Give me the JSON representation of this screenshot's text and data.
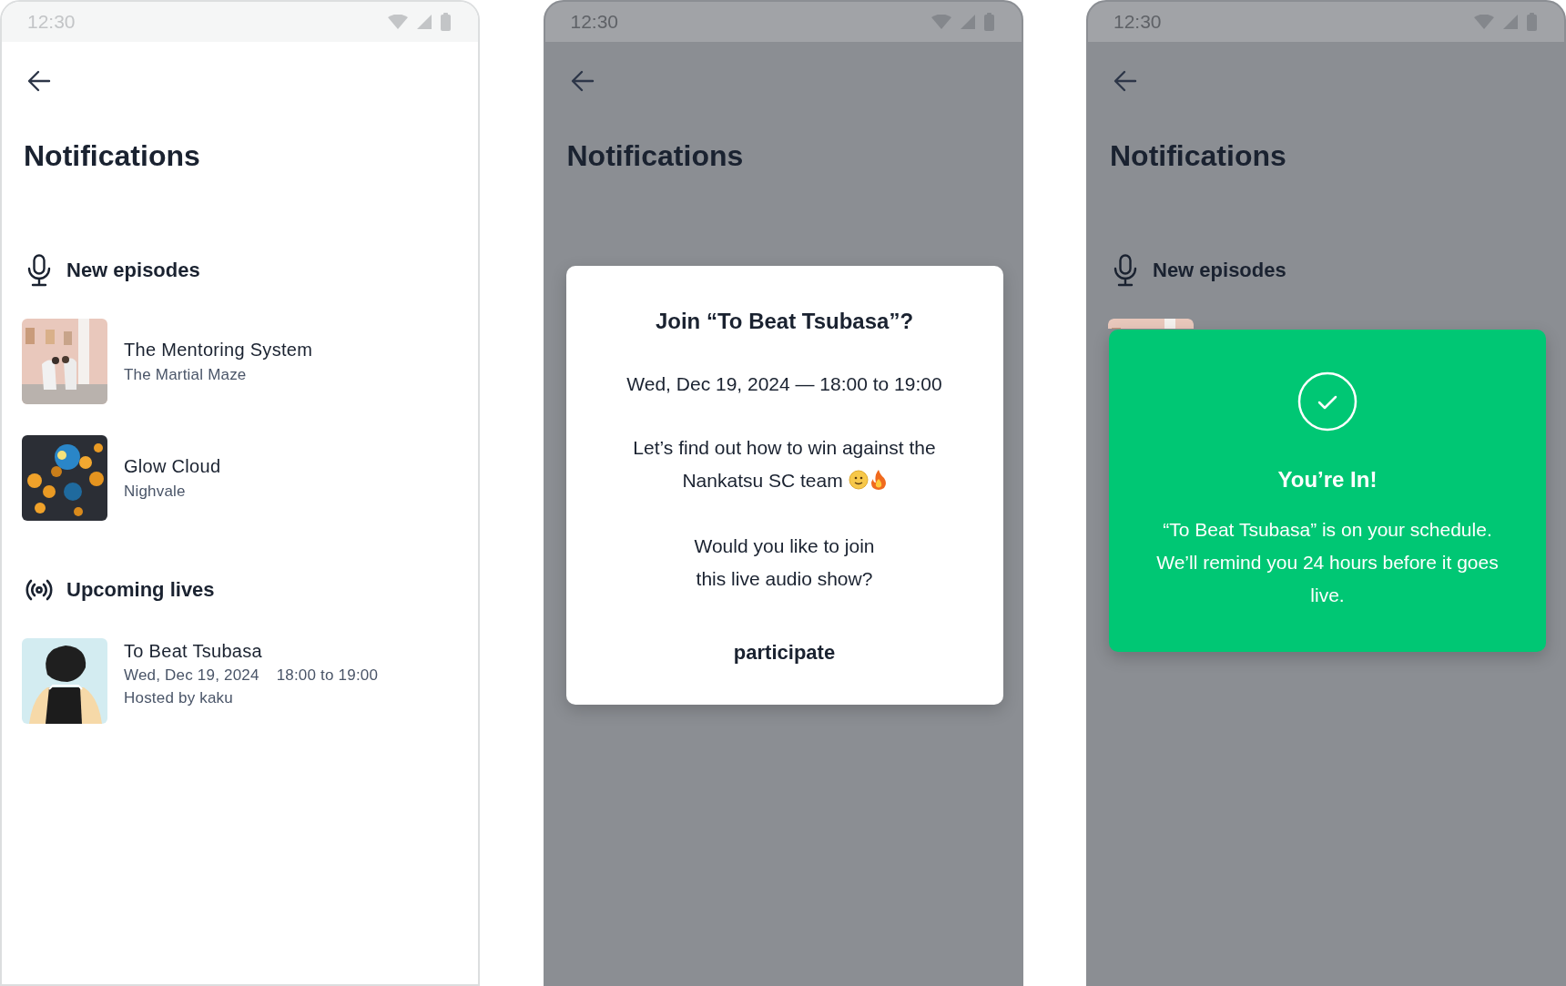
{
  "screens": [
    {
      "status_bar": {
        "time": "12:30"
      },
      "dimmed": false,
      "title": "Notifications",
      "sections": [
        {
          "kind": "episodes",
          "heading": "New episodes",
          "items": [
            {
              "kind": "episode",
              "title": "The Mentoring System",
              "subtitle": "The Martial Maze"
            },
            {
              "kind": "episode",
              "title": "Glow Cloud",
              "subtitle": "Nighvale"
            }
          ]
        },
        {
          "kind": "lives",
          "heading": "Upcoming lives",
          "items": [
            {
              "kind": "live",
              "title": "To Beat Tsubasa",
              "date": "Wed, Dec 19, 2024",
              "time": "18:00 to 19:00",
              "host": "Hosted by kaku"
            }
          ]
        }
      ]
    },
    {
      "status_bar": {
        "time": "12:30"
      },
      "dimmed": true,
      "title": "Notifications",
      "dialog": {
        "title": "Join “To Beat Tsubasa”?",
        "date": "Wed, Dec 19, 2024 — 18:00 to 19:00",
        "message": "Let’s find out how to win against the Nankatsu SC team",
        "question": "Would you like to join\nthis live audio show?",
        "button": "participate"
      }
    },
    {
      "status_bar": {
        "time": "12:30"
      },
      "dimmed": true,
      "title": "Notifications",
      "sections": [
        {
          "kind": "episodes",
          "heading": "New episodes",
          "items": [
            {
              "kind": "peek"
            }
          ]
        }
      ],
      "toast": {
        "title": "You’re In!",
        "message": "“To Beat Tsubasa” is on your schedule. We’ll remind you 24 hours before it goes live."
      }
    }
  ]
}
